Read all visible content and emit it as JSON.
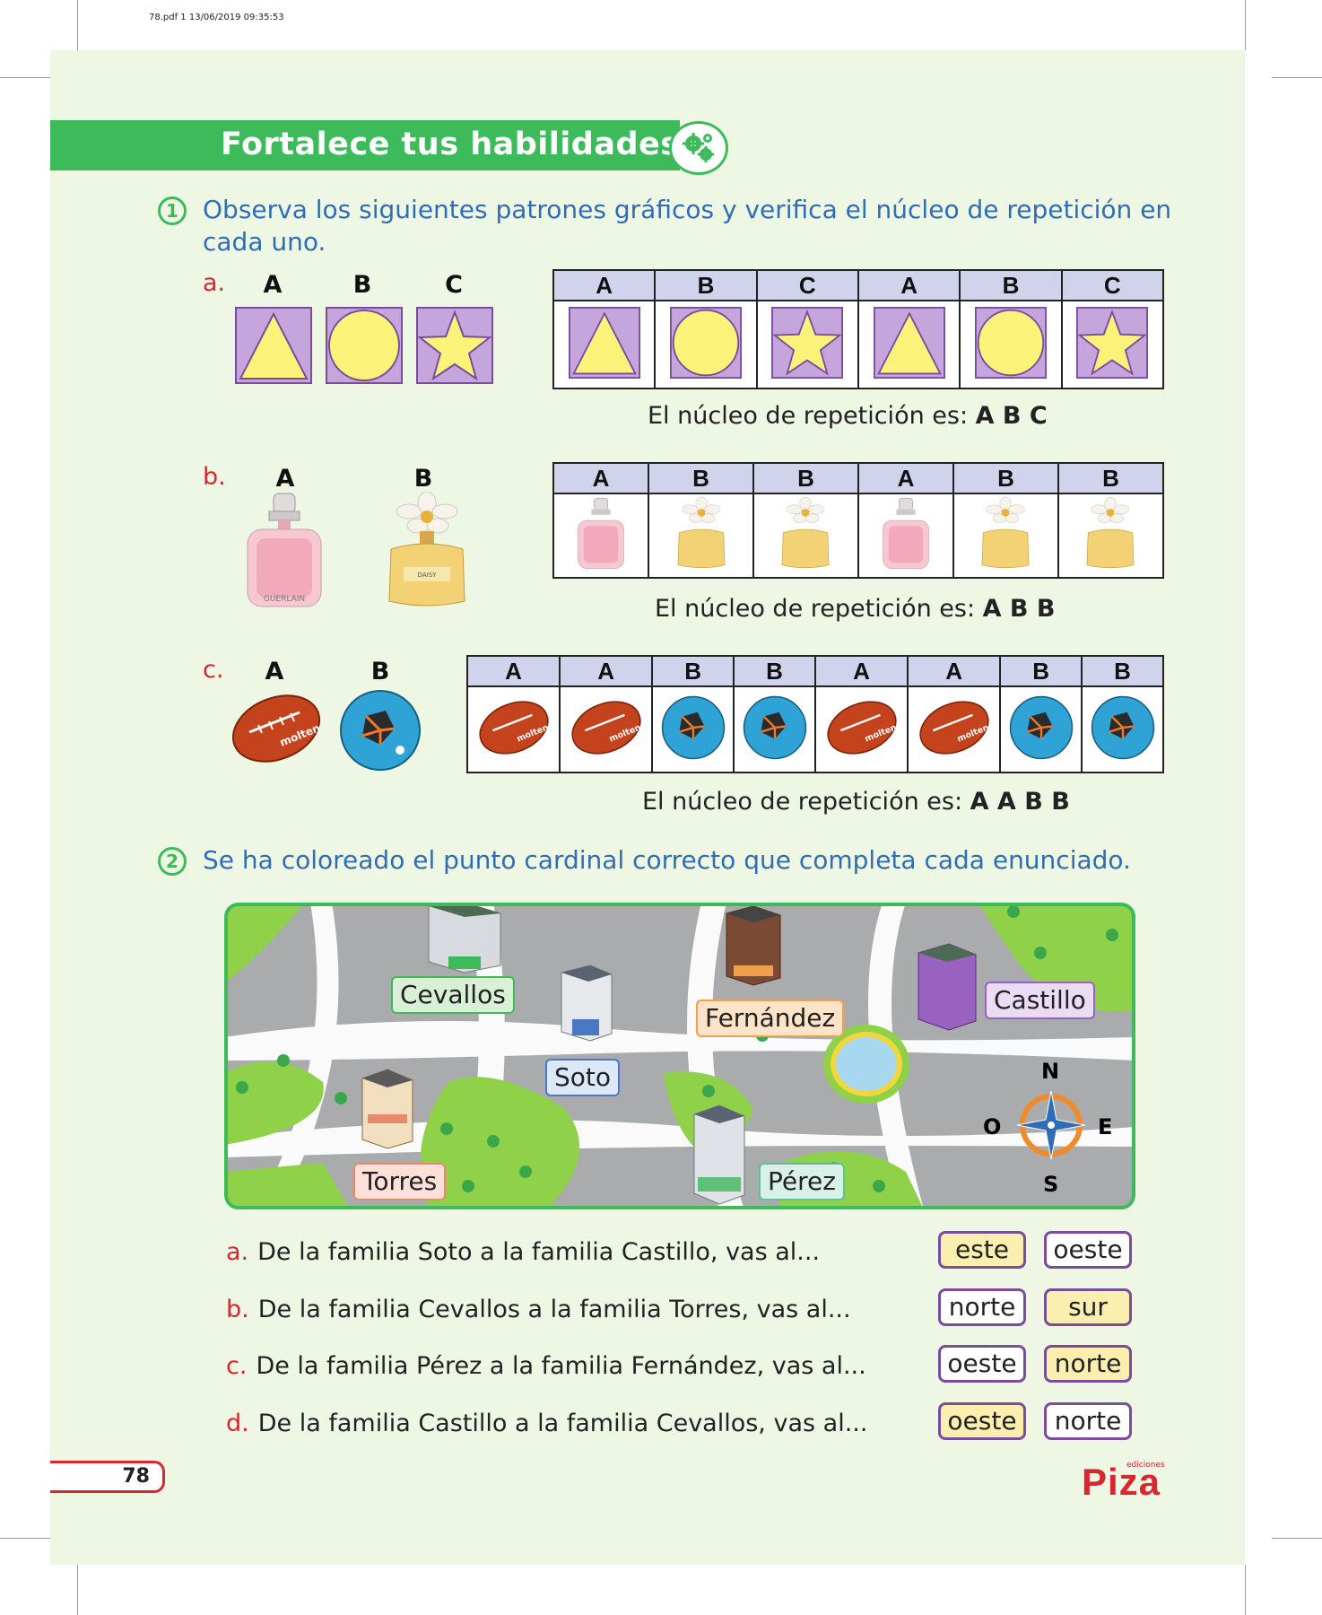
{
  "print_info": "78.pdf   1   13/06/2019   09:35:53",
  "header": {
    "title": "Fortalece tus habilidades",
    "icon": "gears-icon"
  },
  "ex1": {
    "number": "1",
    "instruction": "Observa los siguientes patrones gráficos y verifica el núcleo de repetición en cada uno.",
    "a": {
      "letter": "a.",
      "legend": [
        "A",
        "B",
        "C"
      ],
      "sequence": [
        "A",
        "B",
        "C",
        "A",
        "B",
        "C"
      ],
      "answer_prefix": "El núcleo de repetición es: ",
      "answer": "A B C"
    },
    "b": {
      "letter": "b.",
      "legend": [
        "A",
        "B"
      ],
      "sequence": [
        "A",
        "B",
        "B",
        "A",
        "B",
        "B"
      ],
      "answer_prefix": "El núcleo de repetición es: ",
      "answer": "A B B"
    },
    "c": {
      "letter": "c.",
      "legend": [
        "A",
        "B"
      ],
      "sequence": [
        "A",
        "A",
        "B",
        "B",
        "A",
        "A",
        "B",
        "B"
      ],
      "answer_prefix": "El núcleo de repetición es: ",
      "answer": "A A B B"
    }
  },
  "ex2": {
    "number": "2",
    "instruction": "Se ha coloreado el punto cardinal correcto que completa cada enunciado.",
    "map_labels": {
      "cevallos": "Cevallos",
      "fernandez": "Fernández",
      "castillo": "Castillo",
      "soto": "Soto",
      "torres": "Torres",
      "perez": "Pérez"
    },
    "compass": {
      "n": "N",
      "s": "S",
      "e": "E",
      "o": "O"
    },
    "questions": [
      {
        "letter": "a.",
        "text": "De la familia Soto a la familia Castillo, vas al...",
        "options": [
          "este",
          "oeste"
        ],
        "selected": 0
      },
      {
        "letter": "b.",
        "text": "De la familia Cevallos a la familia Torres, vas al...",
        "options": [
          "norte",
          "sur"
        ],
        "selected": 1
      },
      {
        "letter": "c.",
        "text": "De la familia Pérez a la familia Fernández, vas al...",
        "options": [
          "oeste",
          "norte"
        ],
        "selected": 1
      },
      {
        "letter": "d.",
        "text": "De la familia Castillo a la familia Cevallos, vas al...",
        "options": [
          "oeste",
          "norte"
        ],
        "selected": 0
      }
    ]
  },
  "footer": {
    "page_number": "78",
    "logo": "Piza",
    "logo_sub": "ediciones"
  },
  "colors": {
    "green": "#3dbb5b",
    "blue_text": "#2f6eb5",
    "red": "#d9262f",
    "purple_square": "#c4a6dc",
    "yellow_shape": "#fbf27a",
    "selected_option": "#fbefb0"
  }
}
